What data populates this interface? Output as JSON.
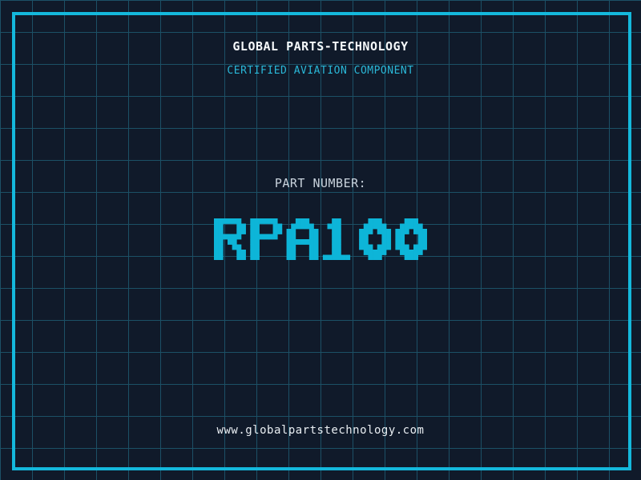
{
  "header": {
    "company": "GLOBAL PARTS-TECHNOLOGY",
    "tagline": "CERTIFIED AVIATION COMPONENT"
  },
  "part": {
    "label": "PART NUMBER:",
    "number": "RPA100"
  },
  "footer": {
    "website": "www.globalpartstechnology.com"
  },
  "colors": {
    "background": "#101a2a",
    "grid_line": "#1c5066",
    "accent_cyan": "#14b8dc",
    "pixel_text_cyan": "#0db5d8",
    "subtitle_cyan": "#2ab8d8",
    "title_white": "#f5f8fa",
    "label_gray": "#c9d3dd",
    "url_white": "#e9eef2"
  }
}
